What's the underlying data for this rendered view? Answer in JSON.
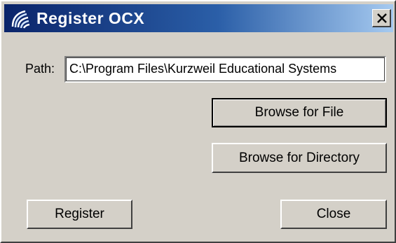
{
  "window": {
    "title": "Register OCX",
    "icon": "swirl-app-icon",
    "close_glyph": "close-icon"
  },
  "path": {
    "label": "Path:",
    "value": "C:\\Program Files\\Kurzweil Educational Systems"
  },
  "buttons": {
    "browse_file": "Browse for File",
    "browse_directory": "Browse for Directory",
    "register": "Register",
    "close": "Close"
  },
  "colors": {
    "titlebar_start": "#0a246a",
    "titlebar_end": "#a6caf0",
    "face": "#d4d0c8"
  }
}
